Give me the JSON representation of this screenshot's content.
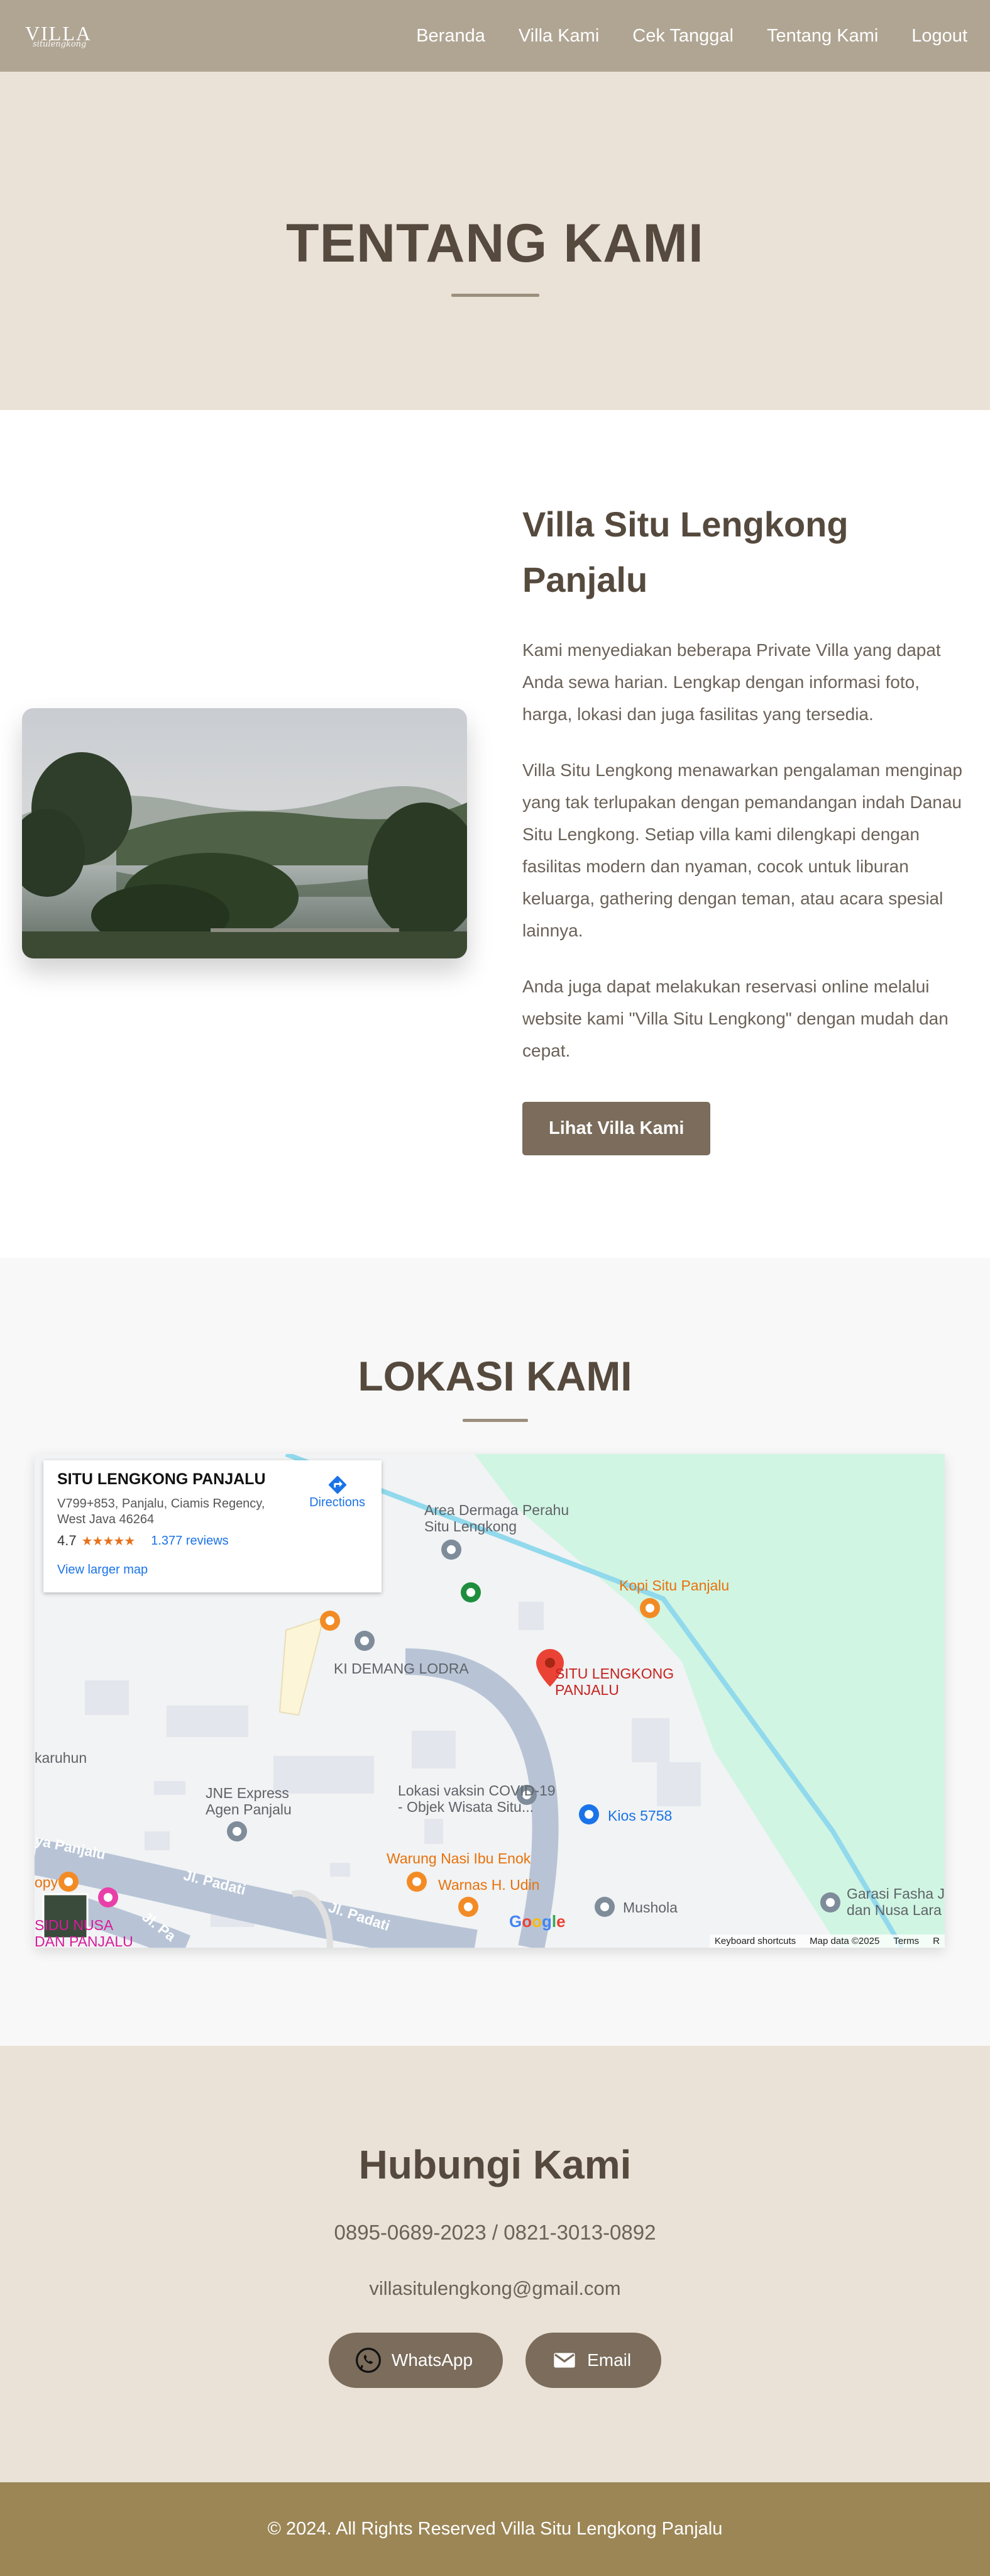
{
  "brand": {
    "logo_main": "VILLA",
    "logo_sub": "situlengkong"
  },
  "nav": {
    "items": [
      "Beranda",
      "Villa Kami",
      "Cek Tanggal",
      "Tentang Kami",
      "Logout"
    ]
  },
  "hero": {
    "title": "TENTANG KAMI"
  },
  "about": {
    "title": "Villa Situ Lengkong Panjalu",
    "paragraphs": [
      "Kami menyediakan beberapa Private Villa yang dapat Anda sewa harian. Lengkap dengan informasi foto, harga, lokasi dan juga fasilitas yang tersedia.",
      "Villa Situ Lengkong menawarkan pengalaman menginap yang tak terlupakan dengan pemandangan indah Danau Situ Lengkong. Setiap villa kami dilengkapi dengan fasilitas modern dan nyaman, cocok untuk liburan keluarga, gathering dengan teman, atau acara spesial lainnya.",
      "Anda juga dapat melakukan reservasi online melalui website kami \"Villa Situ Lengkong\" dengan mudah dan cepat."
    ],
    "button": "Lihat Villa Kami"
  },
  "location": {
    "title": "LOKASI KAMI",
    "map": {
      "card_name": "SITU LENGKONG PANJALU",
      "card_address": "V799+853, Panjalu, Ciamis Regency, West Java 46264",
      "rating": "4.7",
      "stars": "★★★★★",
      "reviews": "1.377 reviews",
      "larger_map": "View larger map",
      "directions": "Directions",
      "labels": {
        "dermaga": "Area Dermaga Perahu\nSitu Lengkong",
        "kopi": "Kopi Situ Panjalu",
        "situ": "SITU LENGKONG\nPANJALU",
        "demang": "KI DEMANG LODRA",
        "karuhun": "karuhun",
        "jne": "JNE Express\nAgen Panjalu",
        "vaksin": "Lokasi vaksin COVID-19\n- Objek Wisata Situ...",
        "kios": "Kios 5758",
        "warung": "Warung Nasi Ibu Enok",
        "warnas": "Warnas H. Udin",
        "mushola": "Mushola",
        "garasi": "Garasi Fasha J\ndan Nusa Lara",
        "panjalu_road": "ya Panjalu",
        "padati1": "Jl. Padati",
        "padati2": "Jl. Padati",
        "padati3": "Jl. Pa",
        "nusa": "SIDU NUSA\nDAN PANJALU",
        "opy": "opy"
      },
      "footer": [
        "Keyboard shortcuts",
        "Map data ©2025",
        "Terms",
        "R"
      ],
      "google": "Google"
    }
  },
  "contact": {
    "title": "Hubungi Kami",
    "phone": "0895-0689-2023 / 0821-3013-0892",
    "email": "villasitulengkong@gmail.com",
    "whatsapp_label": "WhatsApp",
    "email_label": "Email"
  },
  "footer": {
    "text": "© 2024. All Rights Reserved Villa Situ Lengkong Panjalu"
  },
  "colors": {
    "nav": "#b0a593",
    "hero_bg": "#eae2d6",
    "primary_btn": "#7b6c5b",
    "footer": "#9c8656",
    "heading": "#554a3d"
  }
}
